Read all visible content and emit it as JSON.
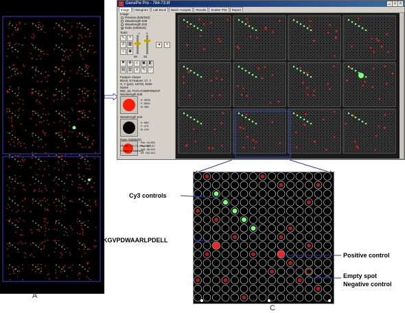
{
  "window": {
    "title": "GenePix Pro - 784-73.tif",
    "tabs": [
      "Image",
      "Histogram",
      "Lab Book",
      "Batch Analysis",
      "Results",
      "Scatter Plot",
      "Report"
    ],
    "active_tab": "Image"
  },
  "controls": {
    "image_section_label": "Image",
    "image_modes": [
      {
        "label": "Preview (635/532)",
        "selected": false
      },
      {
        "label": "Wavelength 635",
        "selected": false
      },
      {
        "label": "Wavelength 532",
        "selected": false
      },
      {
        "label": "Ratio (635/532)",
        "selected": true
      }
    ],
    "tools_label": "Tools",
    "slider_values": [
      "60",
      "33"
    ],
    "feature_viewer_label": "Feature Viewer",
    "block_line": "Block: 8          Feature: 17, 7",
    "xy_line": "X, Y (µm): 19720, 9160",
    "name_label": "Name",
    "name_value": "982_16, TIVO COMPONENT",
    "wavelength635_label": "Wavelength 635",
    "w635_stats": [
      "K: 3500",
      "F: 8500",
      "B: 356"
    ],
    "wavelength532_label": "Wavelength 532",
    "w532_stats": [
      "K: 585",
      "F: 473",
      "B: 478"
    ],
    "ratio_label": "Ratio (635/532)",
    "ratio_stats": [
      "Rm: 16.263",
      "Rm: 277.57",
      "mR: 38.104",
      "rR: 763.312"
    ],
    "footer_line1": "FP=80, FP=73, FP=7969",
    "footer_line2": "0 features selected"
  },
  "annotations": {
    "cy3": "Cy3 controls",
    "peptide": "KGVPDWAARLPDELL",
    "positive": "Positive control",
    "empty_line1": "Empty spot",
    "empty_line2": "Negative control"
  },
  "panel_letters": {
    "a": "A",
    "c": "C"
  },
  "colors": {
    "red_spot": "#e02020",
    "green_spot": "#7cff7c",
    "grid_blue": "#3040d0",
    "window_bg": "#d4d0c8"
  }
}
